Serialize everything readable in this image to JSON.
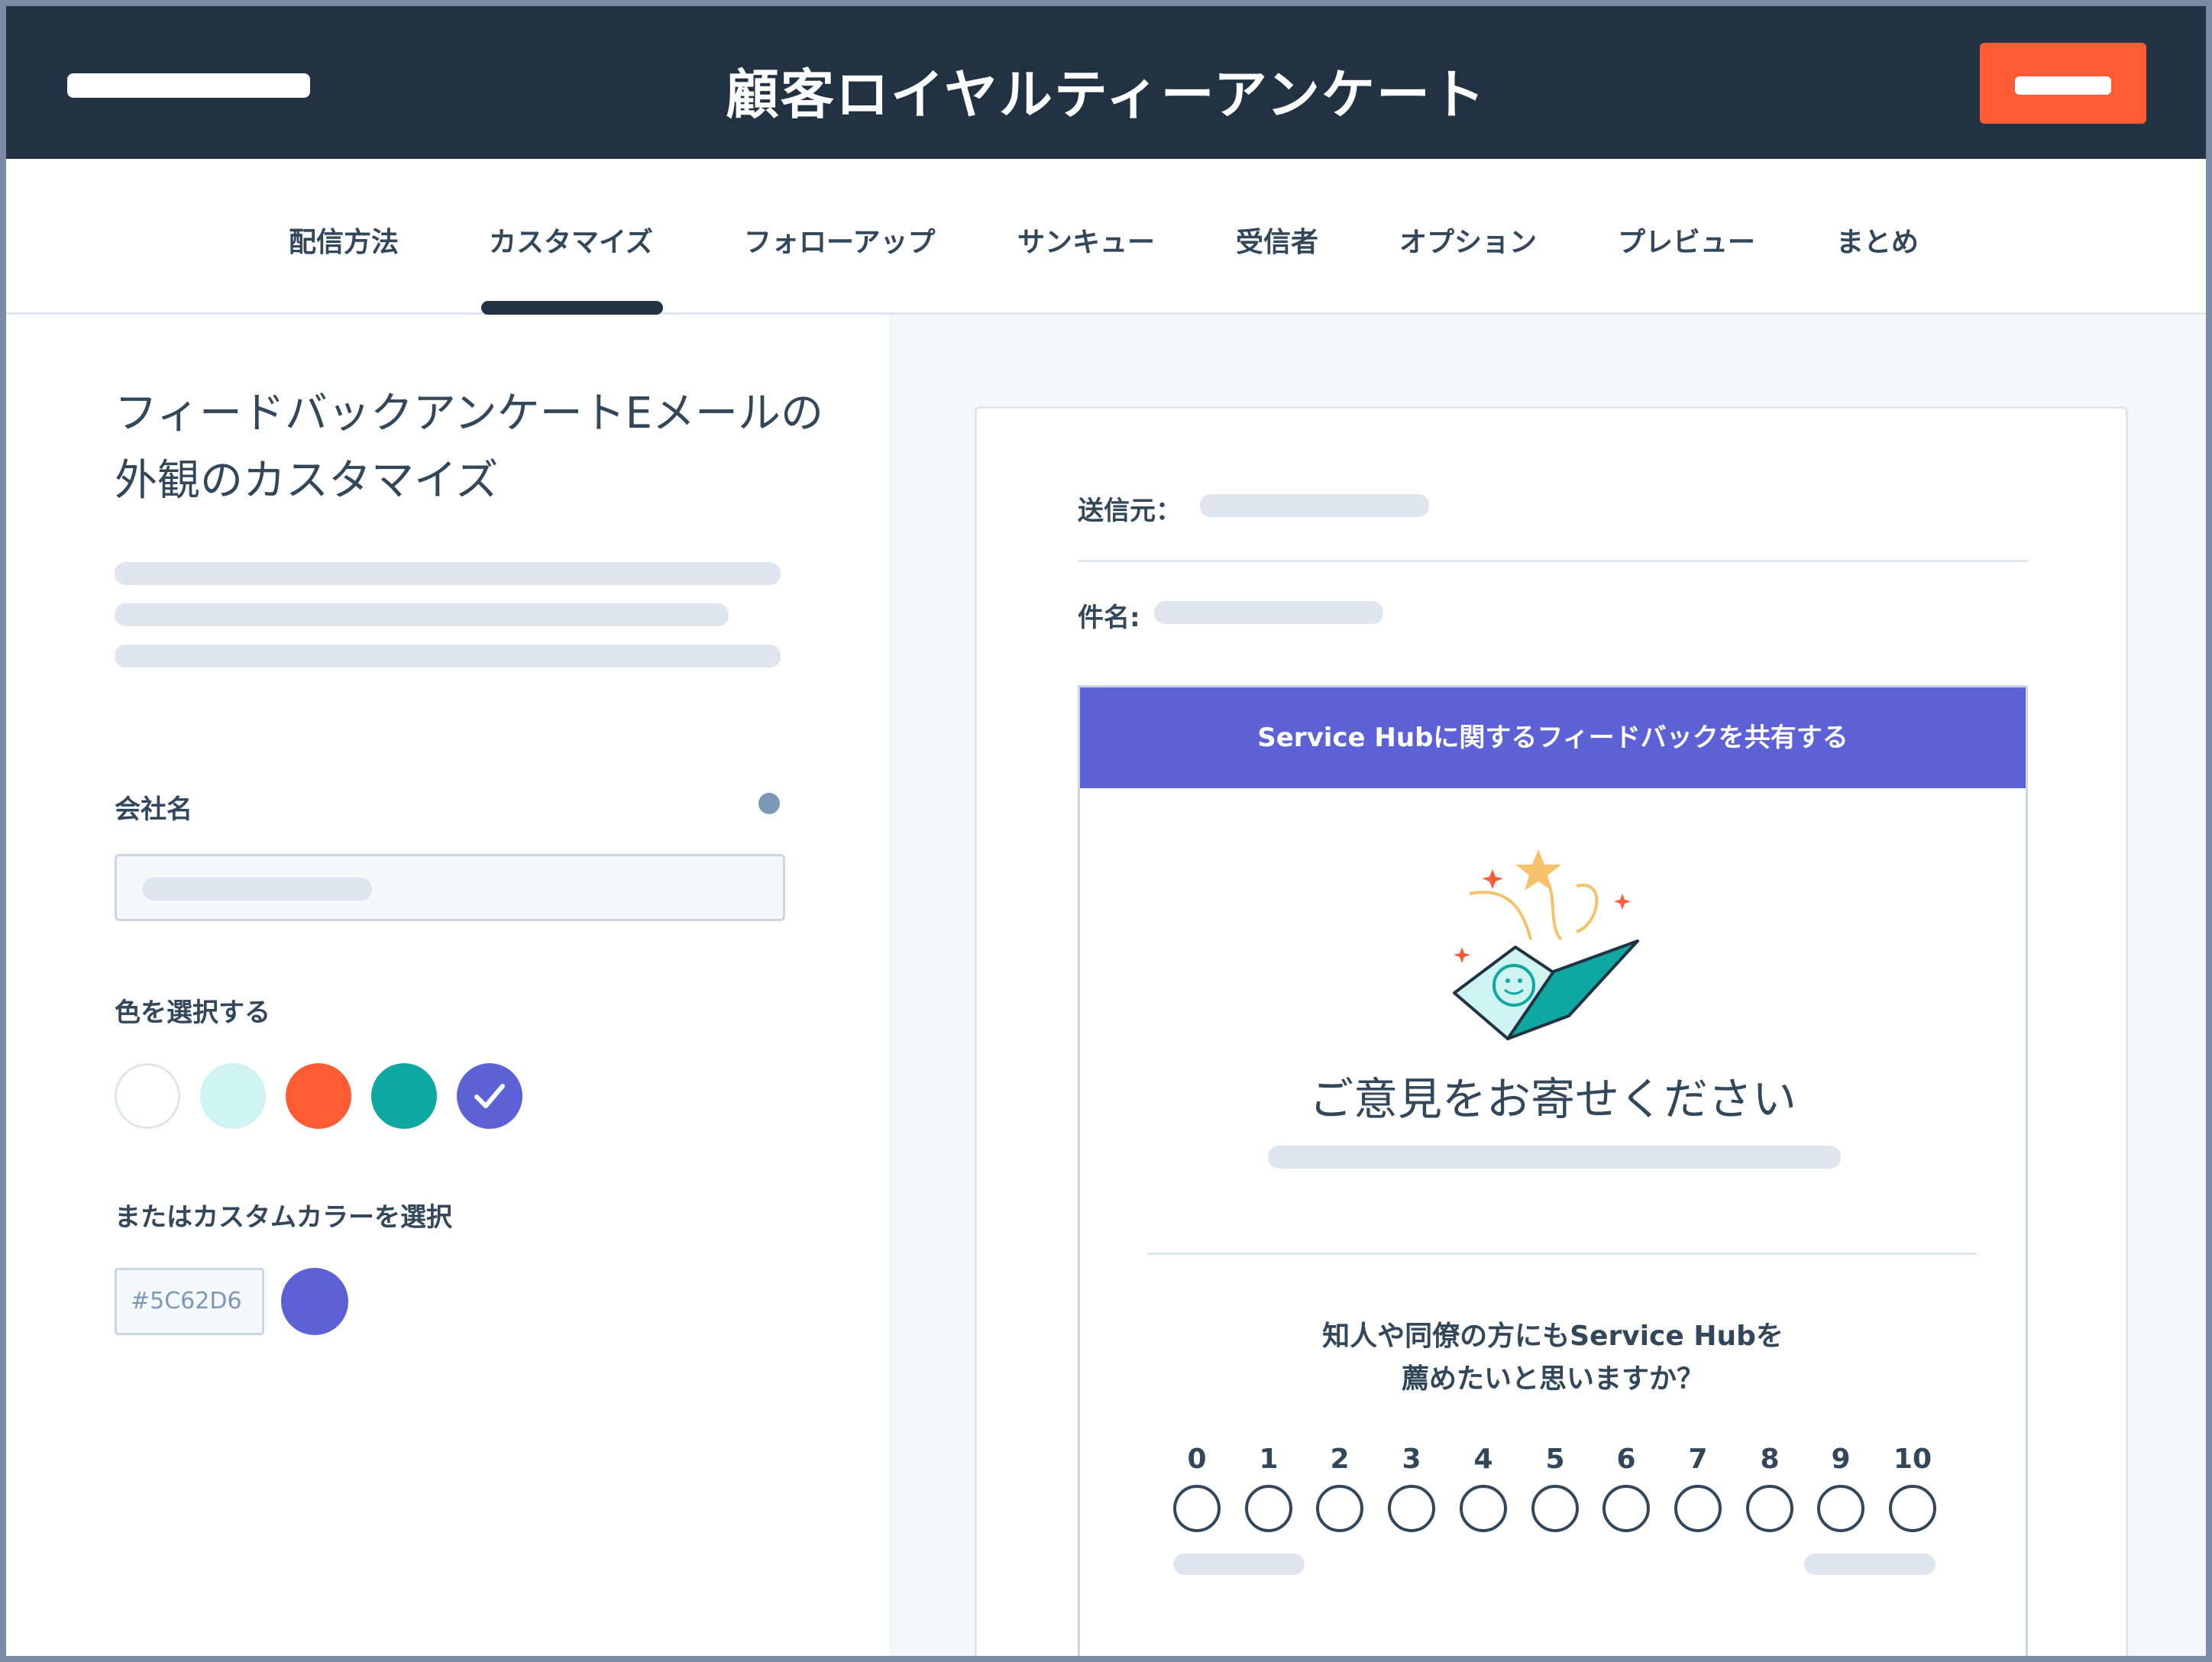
{
  "header": {
    "title": "顧客ロイヤルティーアンケート"
  },
  "tabs": [
    {
      "label": "配信方法"
    },
    {
      "label": "カスタマイズ",
      "active": true
    },
    {
      "label": "フォローアップ"
    },
    {
      "label": "サンキュー"
    },
    {
      "label": "受信者"
    },
    {
      "label": "オプション"
    },
    {
      "label": "プレビュー"
    },
    {
      "label": "まとめ"
    }
  ],
  "left": {
    "heading": "フィードバックアンケートEメールの外観のカスタマイズ",
    "company_label": "会社名",
    "color_label": "色を選択する",
    "colors": [
      "#FFFFFF",
      "#CEF3F1",
      "#FF5C35",
      "#0FA8A0",
      "#5C62D6"
    ],
    "selected_color": "#5C62D6",
    "custom_label": "またはカスタムカラーを選択",
    "custom_hex": "#5C62D6"
  },
  "preview": {
    "from_label": "送信元：",
    "subject_label": "件名:",
    "banner": "Service Hubに関するフィードバックを共有する",
    "feedback_title": "ご意見をお寄せください",
    "question_line1": "知人や同僚の方にもService Hubを",
    "question_line2": "薦めたいと思いますか？",
    "scale": [
      "0",
      "1",
      "2",
      "3",
      "4",
      "5",
      "6",
      "7",
      "8",
      "9",
      "10"
    ]
  },
  "colors": {
    "header_bg": "#213343",
    "accent_orange": "#FF5C35",
    "brand_purple": "#5C62D6",
    "text": "#33475B"
  }
}
